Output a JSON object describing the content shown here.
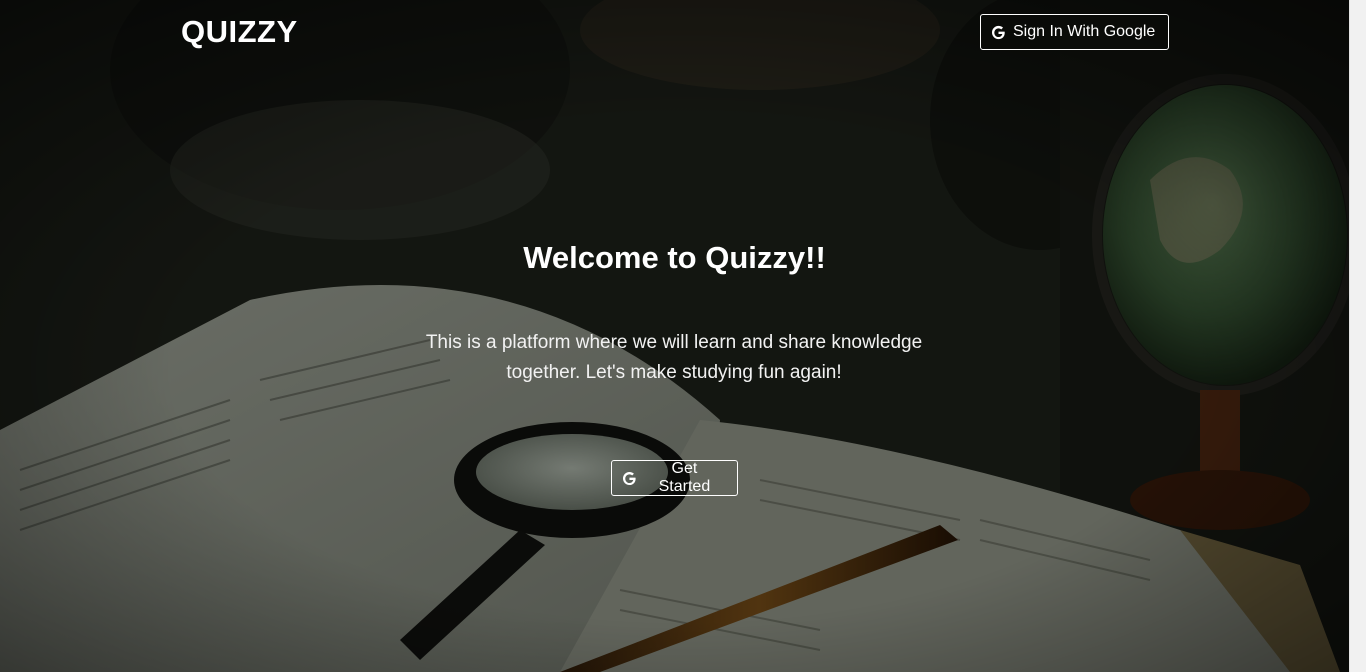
{
  "brand": {
    "name": "QUIZZY"
  },
  "nav": {
    "signin_label": "Sign In With Google",
    "signin_icon": "google-g-icon"
  },
  "hero": {
    "title": "Welcome to Quizzy!!",
    "description": "This is a platform where we will learn and share knowledge together. Let's make studying fun again!",
    "cta_label": "Get Started",
    "cta_icon": "google-g-icon"
  },
  "background": {
    "description_icon": "study-desk-photo",
    "tint": "#000000"
  }
}
